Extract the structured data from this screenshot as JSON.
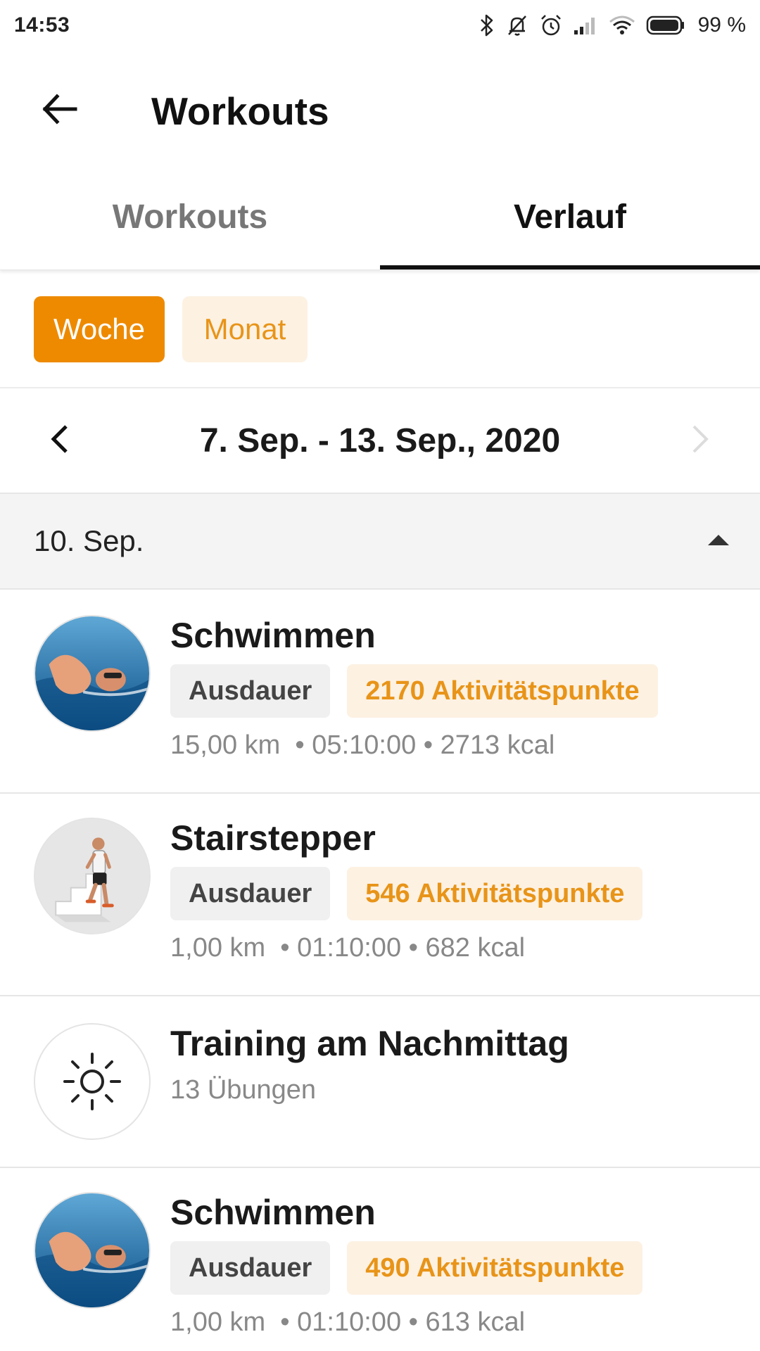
{
  "status_bar": {
    "time": "14:53",
    "battery": "99 %",
    "icons": [
      "bluetooth-icon",
      "muted-bell-icon",
      "alarm-icon",
      "cellular-signal-icon",
      "wifi-icon",
      "battery-icon"
    ]
  },
  "app_bar": {
    "back_icon": "arrow-left-icon",
    "title": "Workouts"
  },
  "tabs": [
    {
      "label": "Workouts",
      "active": false
    },
    {
      "label": "Verlauf",
      "active": true
    }
  ],
  "period": {
    "options": [
      {
        "label": "Woche",
        "selected": true
      },
      {
        "label": "Monat",
        "selected": false
      }
    ]
  },
  "date_range": {
    "label": "7. Sep. - 13. Sep., 2020",
    "prev_icon": "chevron-left-icon",
    "next_icon": "chevron-right-icon"
  },
  "day": {
    "label": "10. Sep.",
    "toggle_icon": "caret-up-icon"
  },
  "workouts": [
    {
      "title": "Schwimmen",
      "image": "swimmer-image",
      "category": "Ausdauer",
      "points": "2170 Aktivitätspunkte",
      "distance": "15,00 km",
      "duration": "05:10:00",
      "energy": "2713 kcal"
    },
    {
      "title": "Stairstepper",
      "image": "stairstepper-image",
      "category": "Ausdauer",
      "points": "546 Aktivitätspunkte",
      "distance": "1,00 km",
      "duration": "01:10:00",
      "energy": "682 kcal"
    },
    {
      "title": "Training am Nachmittag",
      "image": "sun-icon",
      "exercises": "13 Übungen"
    },
    {
      "title": "Schwimmen",
      "image": "swimmer-image",
      "category": "Ausdauer",
      "points": "490 Aktivitätspunkte",
      "distance": "1,00 km",
      "duration": "01:10:00",
      "energy": "613 kcal"
    }
  ],
  "colors": {
    "accent": "#ee8a00",
    "accent_light": "#fdf1e2",
    "accent_text": "#e89418",
    "muted_text": "#888888"
  }
}
